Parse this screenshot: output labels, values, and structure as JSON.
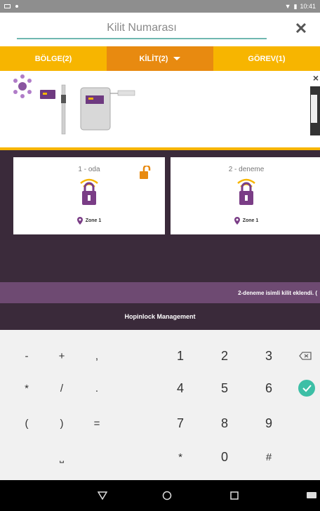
{
  "status_bar": {
    "time": "10:41"
  },
  "search": {
    "placeholder": "Kilit Numarası",
    "clear_glyph": "✕"
  },
  "tabs": [
    {
      "label": "BÖLGE(2)",
      "active": false
    },
    {
      "label": "KİLİT(2)",
      "active": true
    },
    {
      "label": "GÖREV(1)",
      "active": false
    }
  ],
  "banner": {
    "close_glyph": "×"
  },
  "locks": [
    {
      "name": "1 - oda",
      "zone": "Zone 1"
    },
    {
      "name": "2 - deneme",
      "zone": "Zone 1"
    }
  ],
  "toast": "2-deneme isimli kilit eklendi. (",
  "footer_title": "Hopinlock Management",
  "keyboard": {
    "symbols": [
      "-",
      "+",
      ",",
      "*",
      "/",
      ".",
      "(",
      ")",
      "=",
      "⎵"
    ],
    "numbers": [
      "1",
      "2",
      "3",
      "4",
      "5",
      "6",
      "7",
      "8",
      "9",
      "*",
      "0",
      "#"
    ]
  },
  "colors": {
    "accent_yellow": "#f7b500",
    "accent_orange": "#e88a10",
    "brand_purple": "#6e4a72",
    "dark_background": "#3a2a3a",
    "teal": "#3dbfa6"
  }
}
